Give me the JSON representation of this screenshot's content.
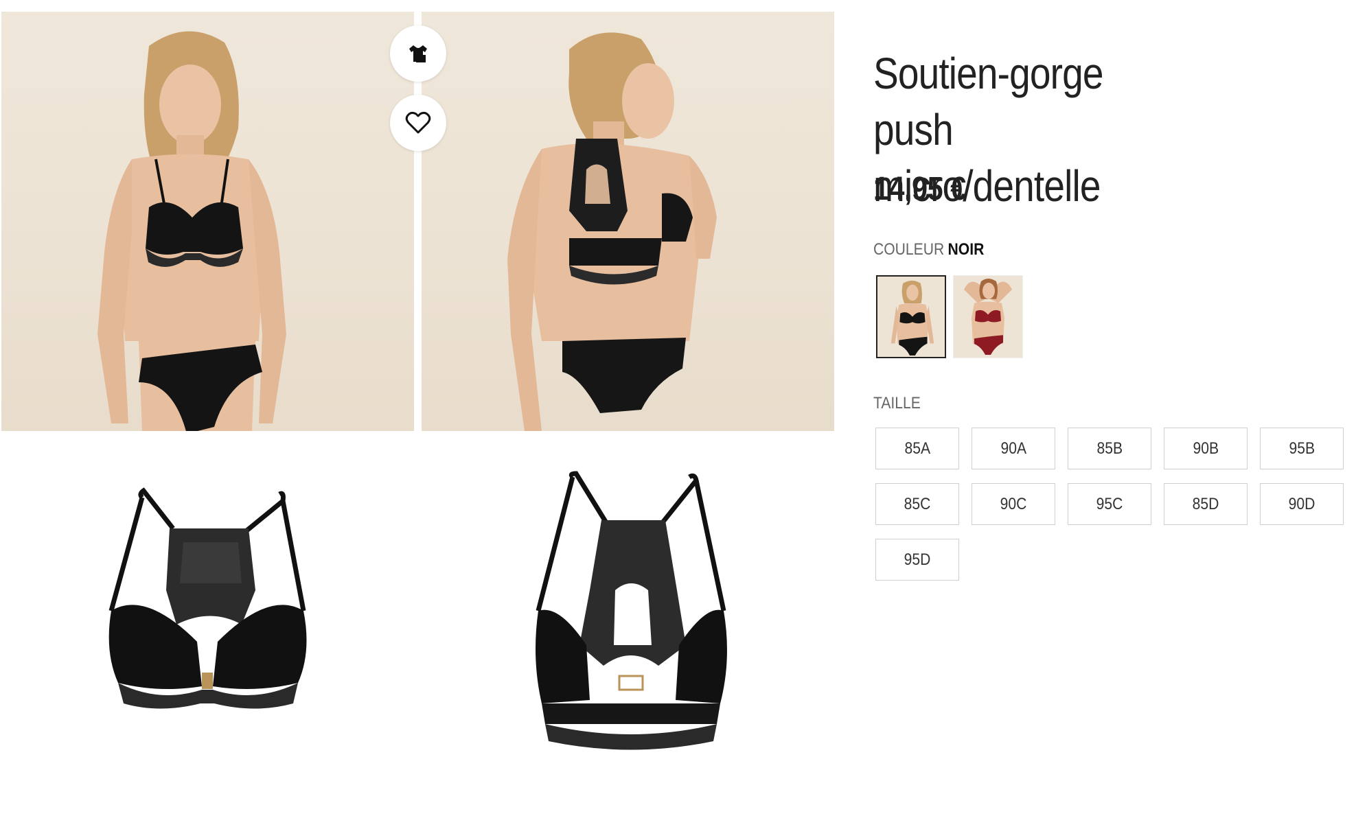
{
  "product": {
    "title": "Soutien-gorge push micro/dentelle",
    "price": "14,95 €"
  },
  "color": {
    "label": "COULEUR",
    "selected": "NOIR",
    "swatches": [
      {
        "name": "noir",
        "hex": "#1a1a1a"
      },
      {
        "name": "bordeaux",
        "hex": "#8e1a24"
      }
    ]
  },
  "size": {
    "label": "TAILLE",
    "options": [
      "85A",
      "90A",
      "85B",
      "90B",
      "95B",
      "85C",
      "90C",
      "95C",
      "85D",
      "90D",
      "95D"
    ]
  },
  "gallery": {
    "actions": [
      "outfit-icon",
      "heart-icon"
    ]
  },
  "colors": {
    "photo_bg": "#ede4d6",
    "text": "#222222",
    "muted": "#666666",
    "border": "#cfcfcf"
  }
}
